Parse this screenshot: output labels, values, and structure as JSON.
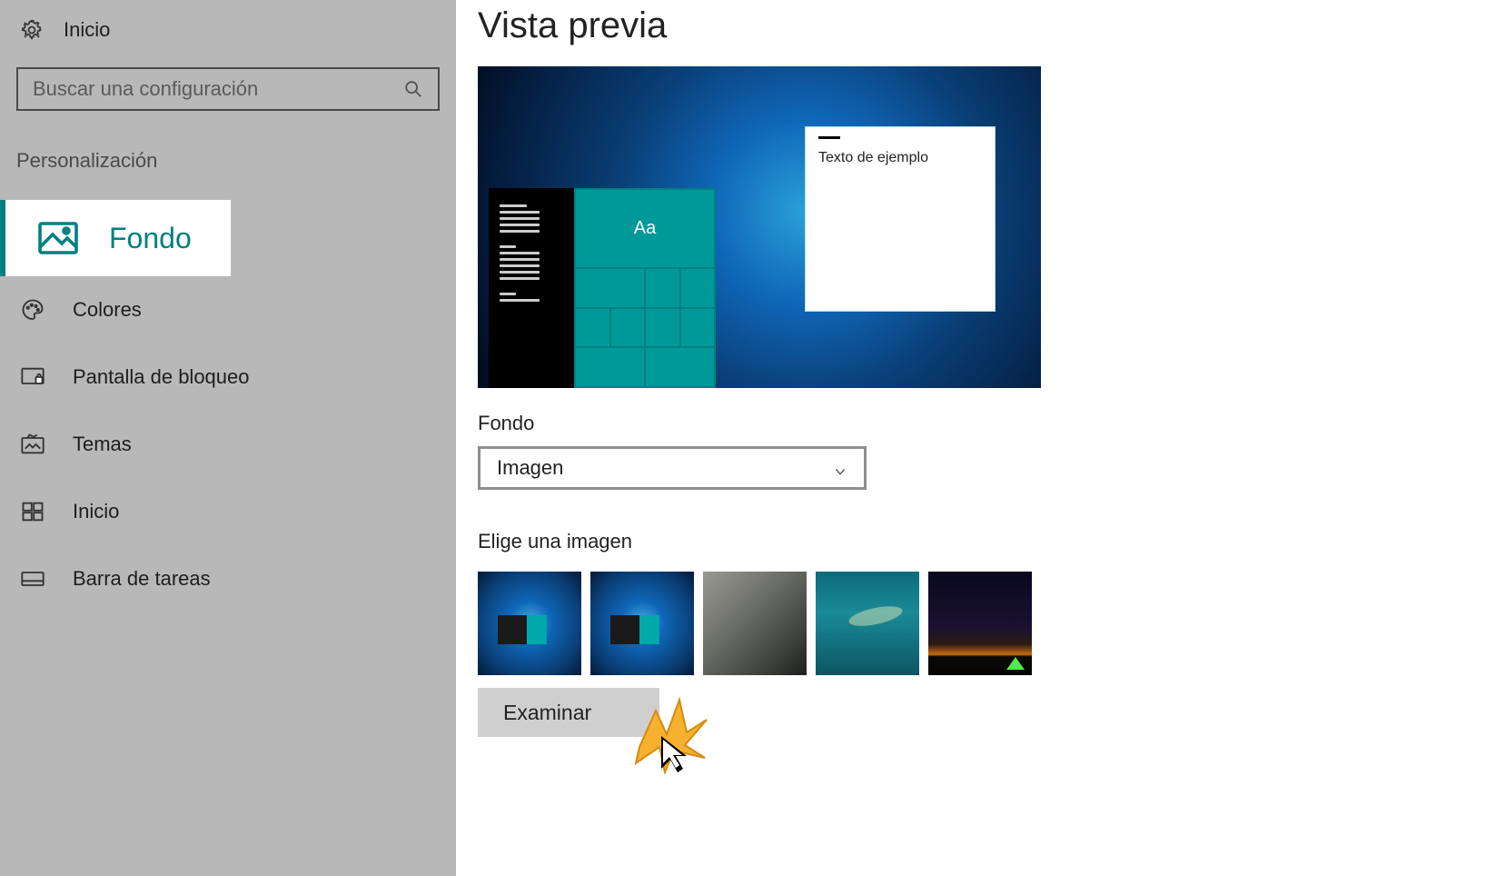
{
  "sidebar": {
    "home_label": "Inicio",
    "search_placeholder": "Buscar una configuración",
    "section_label": "Personalización",
    "items": [
      {
        "label": "Fondo",
        "icon": "image-icon",
        "active": true
      },
      {
        "label": "Colores",
        "icon": "palette-icon"
      },
      {
        "label": "Pantalla de bloqueo",
        "icon": "lock-screen-icon"
      },
      {
        "label": "Temas",
        "icon": "themes-icon"
      },
      {
        "label": "Inicio",
        "icon": "start-menu-icon"
      },
      {
        "label": "Barra de tareas",
        "icon": "taskbar-icon"
      }
    ]
  },
  "main": {
    "title": "Vista previa",
    "preview": {
      "sample_text": "Texto de ejemplo",
      "tile_text": "Aa"
    },
    "background_label": "Fondo",
    "background_dropdown_value": "Imagen",
    "choose_image_label": "Elige una imagen",
    "browse_button": "Examinar",
    "thumbnails": [
      {
        "name": "wallpaper-windows-light"
      },
      {
        "name": "wallpaper-windows-light-2"
      },
      {
        "name": "wallpaper-cliff"
      },
      {
        "name": "wallpaper-underwater"
      },
      {
        "name": "wallpaper-night-camp"
      }
    ]
  },
  "colors": {
    "accent": "#008080"
  }
}
